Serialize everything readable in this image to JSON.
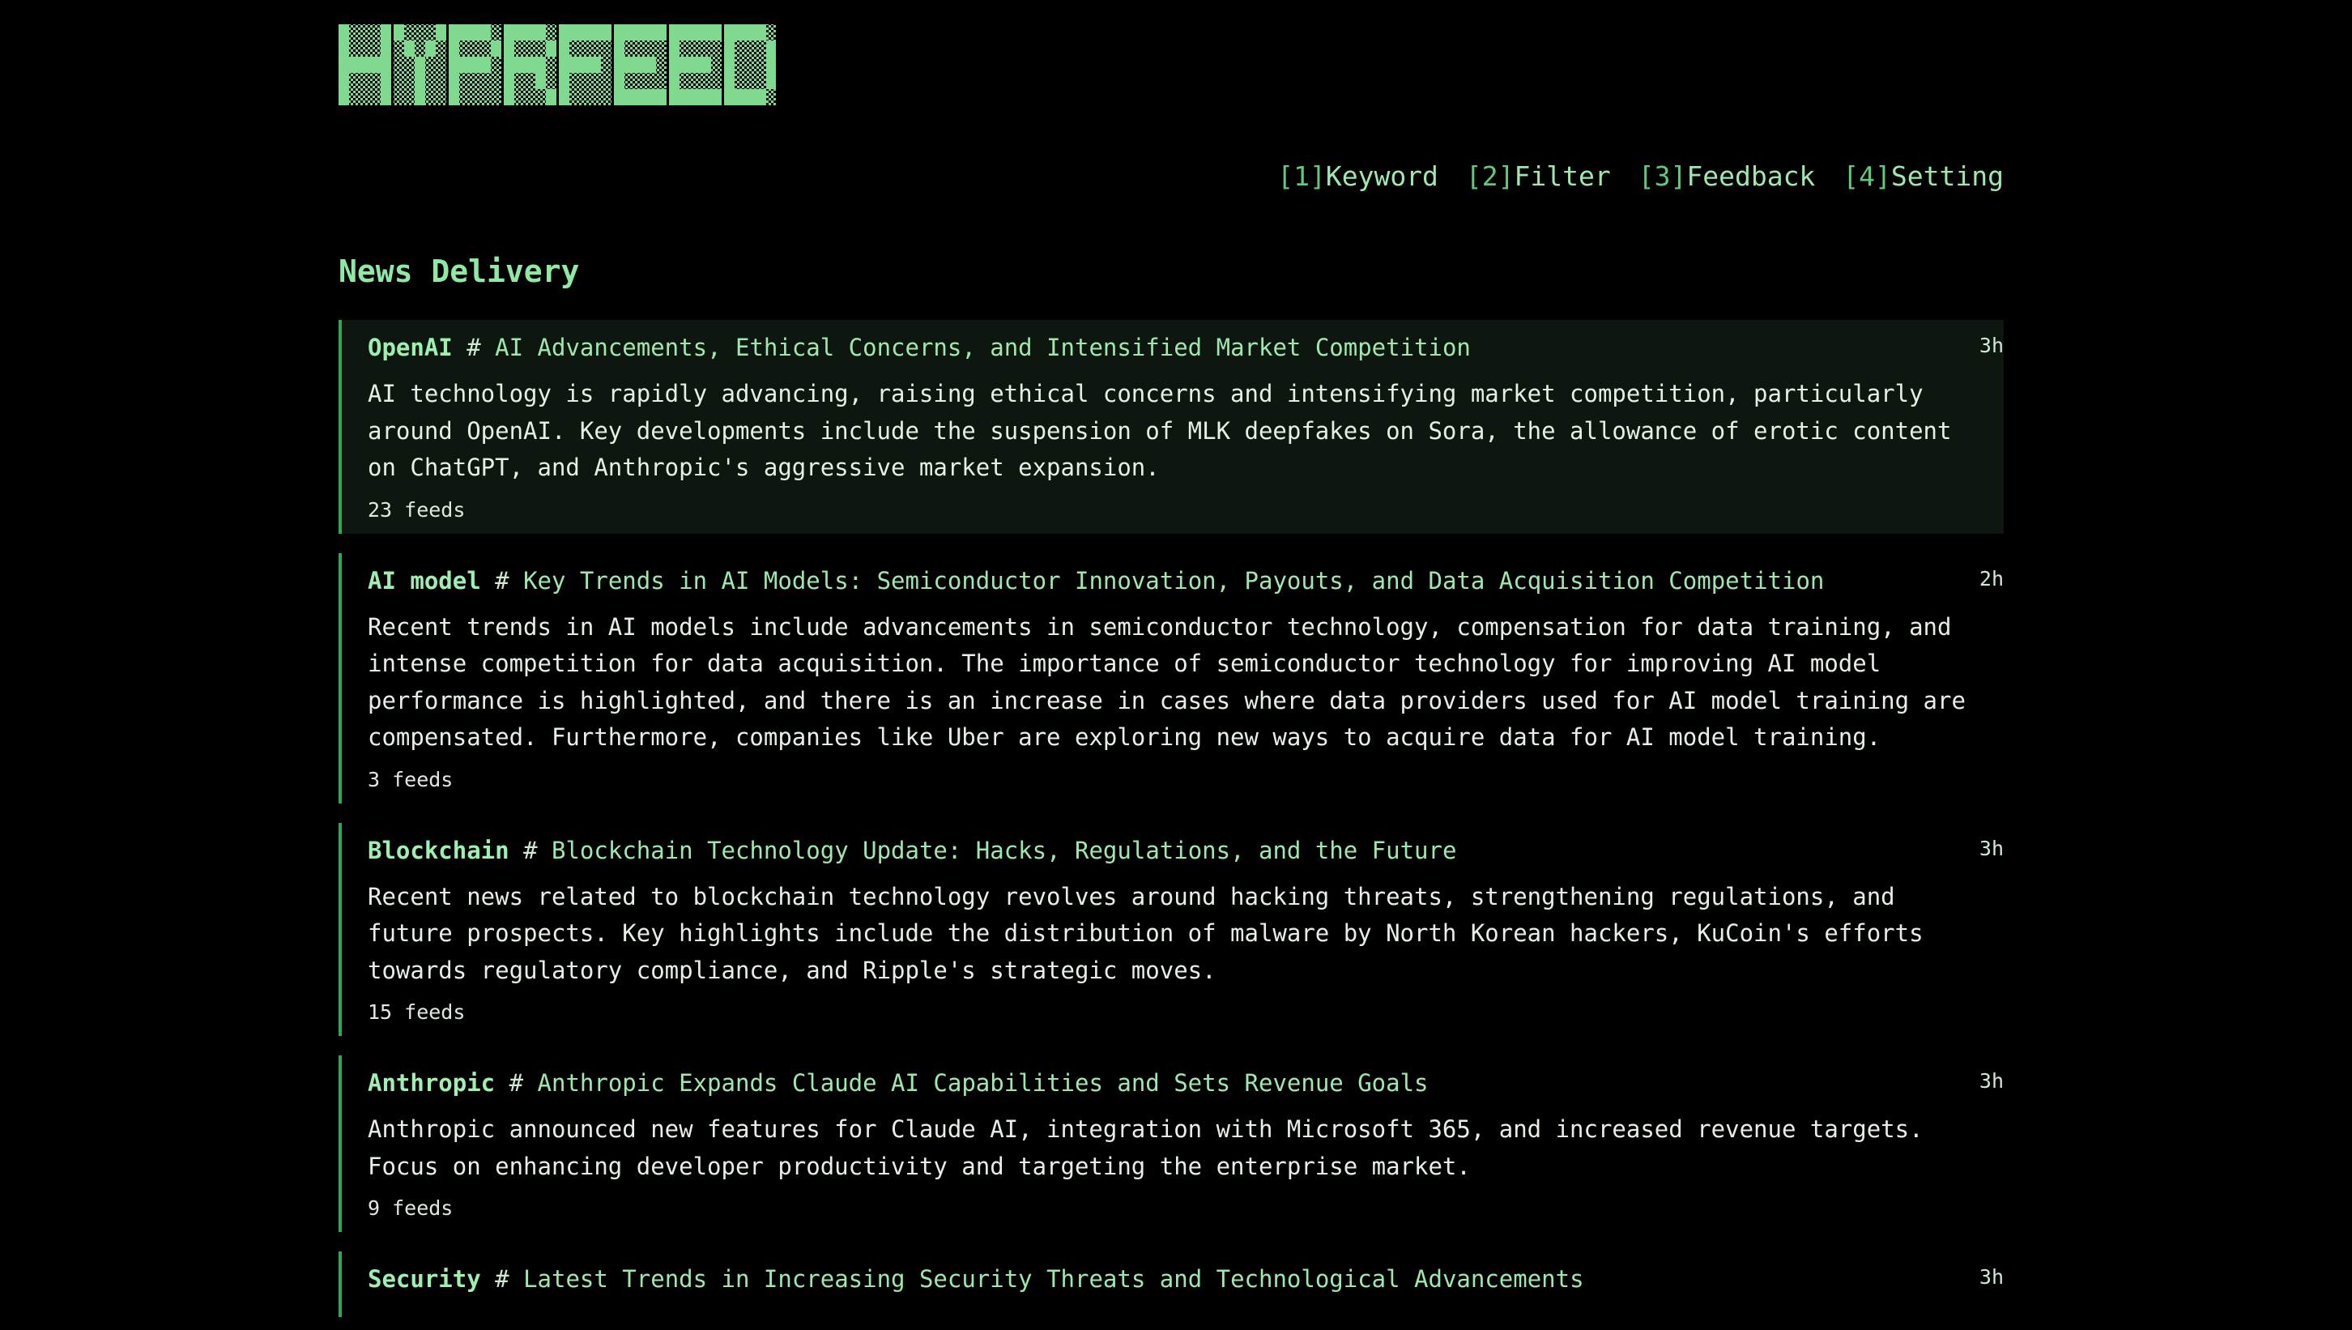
{
  "app": {
    "logo_text": "HYPRFEED"
  },
  "nav": [
    {
      "key": "[1]",
      "label": "Keyword"
    },
    {
      "key": "[2]",
      "label": "Filter"
    },
    {
      "key": "[3]",
      "label": "Feedback"
    },
    {
      "key": "[4]",
      "label": "Setting"
    }
  ],
  "section": {
    "title": "News Delivery"
  },
  "feeds": [
    {
      "tag": "OpenAI",
      "hash": "#",
      "title": "AI Advancements, Ethical Concerns, and Intensified Market Competition",
      "time": "3h",
      "summary": "AI technology is rapidly advancing, raising ethical concerns and intensifying market competition, particularly around OpenAI. Key developments include the suspension of MLK deepfakes on Sora, the allowance of erotic content on ChatGPT, and Anthropic's aggressive market expansion.",
      "count": "23 feeds"
    },
    {
      "tag": "AI model",
      "hash": "#",
      "title": "Key Trends in AI Models: Semiconductor Innovation, Payouts, and Data Acquisition Competition",
      "time": "2h",
      "summary": "Recent trends in AI models include advancements in semiconductor technology, compensation for data training, and intense competition for data acquisition. The importance of semiconductor technology for improving AI model performance is highlighted, and there is an increase in cases where data providers used for AI model training are compensated. Furthermore, companies like Uber are exploring new ways to acquire data for AI model training.",
      "count": "3 feeds"
    },
    {
      "tag": "Blockchain",
      "hash": "#",
      "title": "Blockchain Technology Update: Hacks, Regulations, and the Future",
      "time": "3h",
      "summary": "Recent news related to blockchain technology revolves around hacking threats, strengthening regulations, and future prospects. Key highlights include the distribution of malware by North Korean hackers, KuCoin's efforts towards regulatory compliance, and Ripple's strategic moves.",
      "count": "15 feeds"
    },
    {
      "tag": "Anthropic",
      "hash": "#",
      "title": "Anthropic Expands Claude AI Capabilities and Sets Revenue Goals",
      "time": "3h",
      "summary": "Anthropic announced new features for Claude AI, integration with Microsoft 365, and increased revenue targets. Focus on enhancing developer productivity and targeting the enterprise market.",
      "count": "9 feeds"
    },
    {
      "tag": "Security",
      "hash": "#",
      "title": "Latest Trends in Increasing Security Threats and Technological Advancements",
      "time": "3h",
      "summary": "",
      "count": ""
    }
  ],
  "colors": {
    "background": "#000000",
    "accent": "#9fe8ad",
    "border": "#2fa84f",
    "active_card": "#0e170f"
  }
}
